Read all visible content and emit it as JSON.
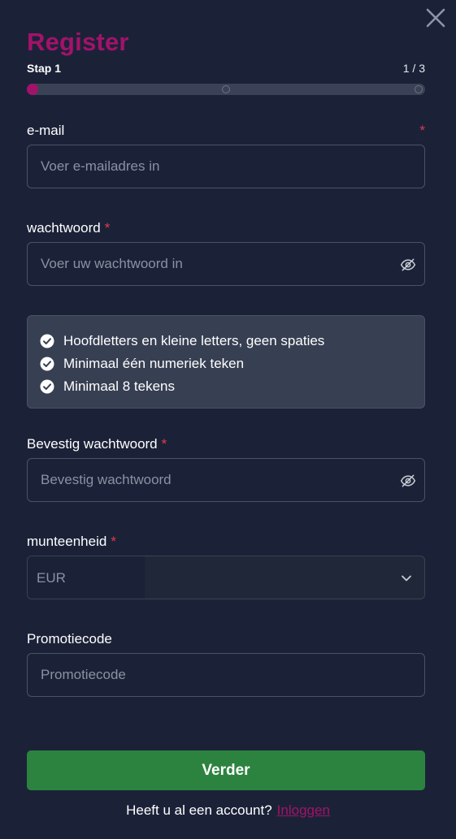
{
  "modal": {
    "title": "Register",
    "close_icon": "close-icon"
  },
  "stepper": {
    "label": "Stap 1",
    "count": "1 / 3",
    "current_step": 1,
    "total_steps": 3,
    "progress": 0
  },
  "form": {
    "email": {
      "label": "e-mail",
      "required_mark": "*",
      "placeholder": "Voer e-mailadres in",
      "value": ""
    },
    "password": {
      "label": "wachtwoord",
      "required_mark": "*",
      "placeholder": "Voer uw wachtwoord in",
      "value": "",
      "toggle_icon": "eye-off-icon"
    },
    "password_rules": [
      {
        "text": "Hoofdletters en kleine letters, geen spaties",
        "icon": "check-circle-icon"
      },
      {
        "text": "Minimaal één numeriek teken",
        "icon": "check-circle-icon"
      },
      {
        "text": "Minimaal 8 tekens",
        "icon": "check-circle-icon"
      }
    ],
    "confirm_password": {
      "label": "Bevestig wachtwoord",
      "required_mark": "*",
      "placeholder": "Bevestig wachtwoord",
      "value": "",
      "toggle_icon": "eye-off-icon"
    },
    "currency": {
      "label": "munteenheid",
      "required_mark": "*",
      "selected": "EUR",
      "icon": "chevron-down-icon"
    },
    "promo": {
      "label": "Promotiecode",
      "placeholder": "Promotiecode",
      "value": ""
    }
  },
  "actions": {
    "submit_label": "Verder",
    "login_prompt": "Heeft u al een account?",
    "login_link": "Inloggen"
  },
  "colors": {
    "background": "#1b2238",
    "accent": "#a3126a",
    "required": "#e23a4d",
    "button": "#2c8340",
    "rules_panel": "#373f52"
  }
}
